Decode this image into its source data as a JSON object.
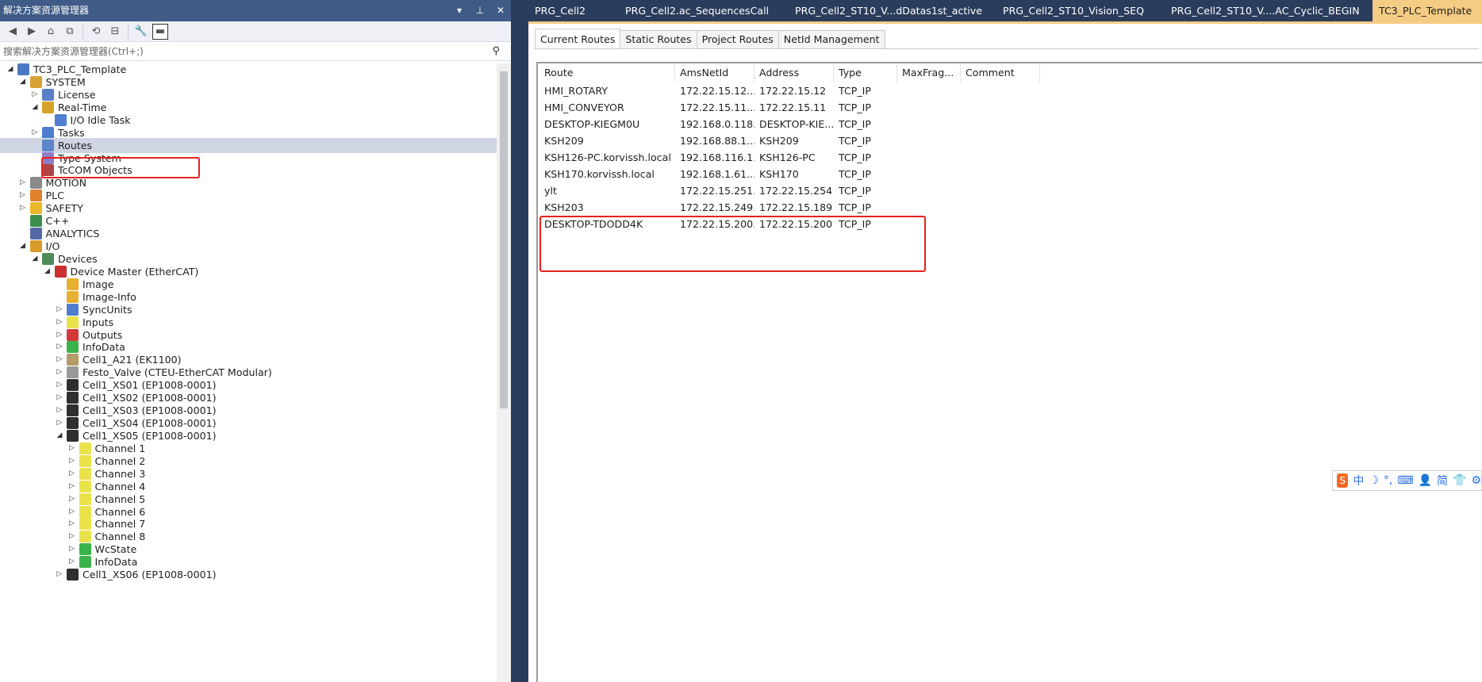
{
  "left_panel": {
    "title": "解决方案资源管理器",
    "title_buttons": [
      "▾",
      "⊥",
      "✕"
    ],
    "search_placeholder": "搜索解决方案资源管理器(Ctrl+;)",
    "tree": [
      {
        "label": "TC3_PLC_Template",
        "level": 0,
        "expander": "expanded",
        "icon": "solution-icon",
        "color": "#4a78c2"
      },
      {
        "label": "SYSTEM",
        "level": 1,
        "expander": "expanded",
        "icon": "system-icon",
        "color": "#d8a235"
      },
      {
        "label": "License",
        "level": 2,
        "expander": "collapsed",
        "icon": "license-icon",
        "color": "#5b7fc7"
      },
      {
        "label": "Real-Time",
        "level": 2,
        "expander": "expanded",
        "icon": "realtime-icon",
        "color": "#d4a12a"
      },
      {
        "label": "I/O Idle Task",
        "level": 3,
        "expander": "none",
        "icon": "task-icon",
        "color": "#4f7ed0"
      },
      {
        "label": "Tasks",
        "level": 2,
        "expander": "collapsed",
        "icon": "tasks-icon",
        "color": "#4f7ed0"
      },
      {
        "label": "Routes",
        "level": 2,
        "expander": "none",
        "icon": "routes-icon",
        "color": "#5b87c9",
        "selected": true
      },
      {
        "label": "Type System",
        "level": 2,
        "expander": "none",
        "icon": "type-system-icon",
        "color": "#8a7cc7"
      },
      {
        "label": "TcCOM Objects",
        "level": 2,
        "expander": "none",
        "icon": "tccom-icon",
        "color": "#b04444"
      },
      {
        "label": "MOTION",
        "level": 1,
        "expander": "collapsed",
        "icon": "motion-icon",
        "color": "#8a8a8a"
      },
      {
        "label": "PLC",
        "level": 1,
        "expander": "collapsed",
        "icon": "plc-icon",
        "color": "#e0822e"
      },
      {
        "label": "SAFETY",
        "level": 1,
        "expander": "collapsed",
        "icon": "safety-icon",
        "color": "#e8b72a"
      },
      {
        "label": "C++",
        "level": 1,
        "expander": "none",
        "icon": "cpp-icon",
        "color": "#3b8d4e"
      },
      {
        "label": "ANALYTICS",
        "level": 1,
        "expander": "none",
        "icon": "analytics-icon",
        "color": "#5569a8"
      },
      {
        "label": "I/O",
        "level": 1,
        "expander": "expanded",
        "icon": "io-icon",
        "color": "#d89a2c"
      },
      {
        "label": "Devices",
        "level": 2,
        "expander": "expanded",
        "icon": "devices-icon",
        "color": "#4e8a58"
      },
      {
        "label": "Device Master (EtherCAT)",
        "level": 3,
        "expander": "expanded",
        "icon": "ethercat-master-icon",
        "color": "#c93030"
      },
      {
        "label": "Image",
        "level": 4,
        "expander": "none",
        "icon": "image-icon",
        "color": "#e8b030"
      },
      {
        "label": "Image-Info",
        "level": 4,
        "expander": "none",
        "icon": "image-info-icon",
        "color": "#e8b030"
      },
      {
        "label": "SyncUnits",
        "level": 4,
        "expander": "collapsed",
        "icon": "syncunits-icon",
        "color": "#4f7ed0"
      },
      {
        "label": "Inputs",
        "level": 4,
        "expander": "collapsed",
        "icon": "inputs-icon",
        "color": "#e9e24a"
      },
      {
        "label": "Outputs",
        "level": 4,
        "expander": "collapsed",
        "icon": "outputs-icon",
        "color": "#d23a3a"
      },
      {
        "label": "InfoData",
        "level": 4,
        "expander": "collapsed",
        "icon": "infodata-icon",
        "color": "#3ab34a"
      },
      {
        "label": "Cell1_A21 (EK1100)",
        "level": 4,
        "expander": "collapsed",
        "icon": "coupler-icon",
        "color": "#b59a6a"
      },
      {
        "label": "Festo_Valve (CTEU-EtherCAT Modular)",
        "level": 4,
        "expander": "collapsed",
        "icon": "valve-icon",
        "color": "#9a9a9a"
      },
      {
        "label": "Cell1_XS01 (EP1008-0001)",
        "level": 4,
        "expander": "collapsed",
        "icon": "terminal-icon",
        "color": "#2f2f2f"
      },
      {
        "label": "Cell1_XS02 (EP1008-0001)",
        "level": 4,
        "expander": "collapsed",
        "icon": "terminal-icon",
        "color": "#2f2f2f"
      },
      {
        "label": "Cell1_XS03 (EP1008-0001)",
        "level": 4,
        "expander": "collapsed",
        "icon": "terminal-icon",
        "color": "#2f2f2f"
      },
      {
        "label": "Cell1_XS04 (EP1008-0001)",
        "level": 4,
        "expander": "collapsed",
        "icon": "terminal-icon",
        "color": "#2f2f2f"
      },
      {
        "label": "Cell1_XS05 (EP1008-0001)",
        "level": 4,
        "expander": "expanded",
        "icon": "terminal-icon",
        "color": "#2f2f2f"
      },
      {
        "label": "Channel 1",
        "level": 5,
        "expander": "collapsed",
        "icon": "channel-icon",
        "color": "#e9e24a"
      },
      {
        "label": "Channel 2",
        "level": 5,
        "expander": "collapsed",
        "icon": "channel-icon",
        "color": "#e9e24a"
      },
      {
        "label": "Channel 3",
        "level": 5,
        "expander": "collapsed",
        "icon": "channel-icon",
        "color": "#e9e24a"
      },
      {
        "label": "Channel 4",
        "level": 5,
        "expander": "collapsed",
        "icon": "channel-icon",
        "color": "#e9e24a"
      },
      {
        "label": "Channel 5",
        "level": 5,
        "expander": "collapsed",
        "icon": "channel-icon",
        "color": "#e9e24a"
      },
      {
        "label": "Channel 6",
        "level": 5,
        "expander": "collapsed",
        "icon": "channel-icon",
        "color": "#e9e24a"
      },
      {
        "label": "Channel 7",
        "level": 5,
        "expander": "collapsed",
        "icon": "channel-icon",
        "color": "#e9e24a"
      },
      {
        "label": "Channel 8",
        "level": 5,
        "expander": "collapsed",
        "icon": "channel-icon",
        "color": "#e9e24a"
      },
      {
        "label": "WcState",
        "level": 5,
        "expander": "collapsed",
        "icon": "wcstate-icon",
        "color": "#3ab34a"
      },
      {
        "label": "InfoData",
        "level": 5,
        "expander": "collapsed",
        "icon": "infodata-icon",
        "color": "#3ab34a"
      },
      {
        "label": "Cell1_XS06 (EP1008-0001)",
        "level": 4,
        "expander": "collapsed",
        "icon": "terminal-icon",
        "color": "#2f2f2f"
      }
    ]
  },
  "doc_tabs": [
    {
      "label": "PRG_Cell2",
      "active": false
    },
    {
      "label": "PRG_Cell2.ac_SequencesCall",
      "active": false
    },
    {
      "label": "PRG_Cell2_ST10_V...dDatas1st_active",
      "active": false
    },
    {
      "label": "PRG_Cell2_ST10_Vision_SEQ",
      "active": false
    },
    {
      "label": "PRG_Cell2_ST10_V....AC_Cyclic_BEGIN",
      "active": false
    },
    {
      "label": "TC3_PLC_Template",
      "active": true
    }
  ],
  "routes_view": {
    "tabs": [
      {
        "label": "Current Routes",
        "active": true
      },
      {
        "label": "Static Routes",
        "active": false
      },
      {
        "label": "Project Routes",
        "active": false
      },
      {
        "label": "NetId Management",
        "active": false
      }
    ],
    "columns": [
      "Route",
      "AmsNetId",
      "Address",
      "Type",
      "MaxFrag...",
      "Comment"
    ],
    "rows": [
      [
        "HMI_ROTARY",
        "172.22.15.12....",
        "172.22.15.12",
        "TCP_IP",
        "",
        ""
      ],
      [
        "HMI_CONVEYOR",
        "172.22.15.11....",
        "172.22.15.11",
        "TCP_IP",
        "",
        ""
      ],
      [
        "DESKTOP-KIEGM0U",
        "192.168.0.118...",
        "DESKTOP-KIE...",
        "TCP_IP",
        "",
        ""
      ],
      [
        "KSH209",
        "192.168.88.1....",
        "KSH209",
        "TCP_IP",
        "",
        ""
      ],
      [
        "KSH126-PC.korvissh.local",
        "192.168.116.1...",
        "KSH126-PC",
        "TCP_IP",
        "",
        ""
      ],
      [
        "KSH170.korvissh.local",
        "192.168.1.61....",
        "KSH170",
        "TCP_IP",
        "",
        ""
      ],
      [
        "ylt",
        "172.22.15.251....",
        "172.22.15.254",
        "TCP_IP",
        "",
        ""
      ],
      [
        "KSH203",
        "172.22.15.249....",
        "172.22.15.189",
        "TCP_IP",
        "",
        ""
      ],
      [
        "DESKTOP-TDODD4K",
        "172.22.15.200....",
        "172.22.15.200",
        "TCP_IP",
        "",
        ""
      ]
    ]
  },
  "ime_toolbar": {
    "logo": "S",
    "items": [
      "中",
      "☽",
      "°,",
      "⌨",
      "👤",
      "简",
      "👕",
      "⚙"
    ]
  },
  "colors": {
    "title_bar": "#3f5b86",
    "background": "#2b3d5c",
    "active_tab": "#f5cc84",
    "selection": "#cfd5e2",
    "highlight_box": "#e8211f"
  }
}
